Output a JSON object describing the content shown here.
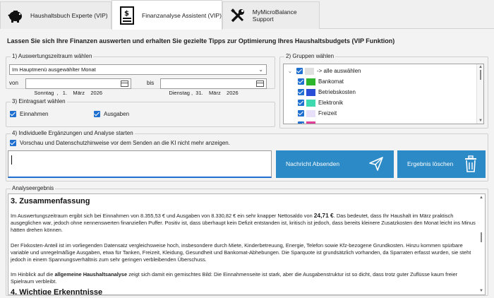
{
  "tabs": [
    {
      "label": "Haushaltsbuch Experte (VIP)",
      "icon": "piggy-bank-icon"
    },
    {
      "label": "Finanzanalyse Assistent (VIP)",
      "icon": "money-document-icon"
    },
    {
      "label": "MyMicroBalance Support",
      "icon": "tools-icon"
    }
  ],
  "headline": "Lassen Sie sich Ihre Finanzen auswerten und erhalten Sie gezielte Tipps zur Optimierung Ihres Haushaltsbudgets (VIP Funktion)",
  "period": {
    "title": "1) Auswertungszeitraum wählen",
    "selected": "Im Hauptmenü ausgewählter Monat",
    "from_label": "von",
    "from": "Sonntag  ,   1.    März    2026",
    "to_label": "bis",
    "to": "Dienstag ,  31.    März    2026"
  },
  "entry_type": {
    "title": "3) Eintragsart wählen",
    "income": "Einnahmen",
    "expenses": "Ausgaben"
  },
  "groups": {
    "title": "2) Gruppen wählen",
    "items": [
      {
        "label": "-> alle auswählen",
        "color": "#e0e0e0"
      },
      {
        "label": "Bankomat",
        "color": "#2db52d"
      },
      {
        "label": "Betriebskosten",
        "color": "#2a4fd6"
      },
      {
        "label": "Elektronik",
        "color": "#3fd9b0"
      },
      {
        "label": "Freizeit",
        "color": "#e8e0f8"
      },
      {
        "label": "",
        "color": "#e0409a"
      }
    ]
  },
  "analysis": {
    "title": "4) Individuelle Ergänzungen und Analyse starten",
    "privacy_checkbox": "Vorschau und Datenschutzhinweise vor dem Senden an die KI nicht mehr anzeigen.",
    "message_value": "",
    "send_button": "Nachricht Absenden",
    "clear_button": "Ergebnis löschen"
  },
  "result": {
    "title": "Analyseergebnis",
    "heading": "3. Zusammenfassung",
    "p1_a": "Im Auswertungszeitraum ergibt sich bei Einnahmen von 8.355,53 € und Ausgaben von 8.330,82 € ein sehr knapper Nettosaldo von ",
    "p1_b": "24,71 €",
    "p1_c": ". Das bedeutet, dass Ihr Haushalt im März praktisch ausgeglichen war, jedoch ohne nennenswerten finanziellen Puffer. Positiv ist, dass überhaupt kein Defizit entstanden ist, kritisch ist jedoch, dass bereits kleinere Zusatzkosten den Monat leicht ins Minus hätten drehen können.",
    "p2": "Der Fixkosten-Anteil ist im vorliegenden Datensatz vergleichsweise hoch, insbesondere durch Miete, Kinderbetreuung, Energie, Telefon sowie Kfz-bezogene Grundkosten. Hinzu kommen spürbare variable und unregelmäßige Ausgaben, etwa für Tanken, Freizeit, Kleidung, Gesundheit und Bankomat-Abhebungen. Die Sparquote ist grundsätzlich vorhanden, da Sparraten erfasst wurden, sie steht jedoch in einem Spannungsverhältnis zum sehr geringen verbleibenden Überschuss.",
    "p3_a": "Im Hinblick auf die ",
    "p3_b": "allgemeine Haushaltsanalyse",
    "p3_c": " zeigt sich damit ein gemischtes Bild: Die Einnahmenseite ist stark, aber die Ausgabenstruktur ist so dicht, dass trotz guter Zuflüsse kaum freier Spielraum verbleibt.",
    "next_heading": "4. Wichtige Erkenntnisse"
  }
}
